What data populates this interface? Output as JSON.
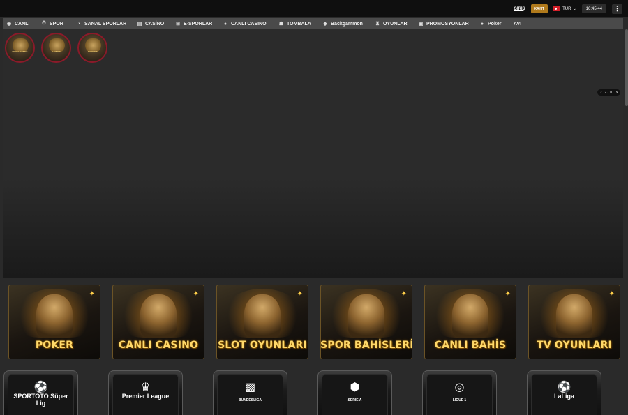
{
  "header": {
    "login_label": "GİRİŞ",
    "register_label": "KAYIT",
    "language": "TUR",
    "clock": "16:45:44",
    "more_icon": "kebab-menu-icon"
  },
  "nav": {
    "items": [
      {
        "label": "CANLI",
        "icon": "live-icon"
      },
      {
        "label": "SPOR",
        "icon": "stopwatch-icon"
      },
      {
        "label": "SANAL SPORLAR",
        "icon": "virtual-sports-icon"
      },
      {
        "label": "CASİNO",
        "icon": "casino-icon"
      },
      {
        "label": "E-SPORLAR",
        "icon": "gamepad-icon"
      },
      {
        "label": "CANLI CASINO",
        "icon": "live-casino-icon"
      },
      {
        "label": "TOMBALA",
        "icon": "bingo-icon"
      },
      {
        "label": "Backgammon",
        "icon": "backgammon-icon"
      },
      {
        "label": "OYUNLAR",
        "icon": "games-icon"
      },
      {
        "label": "PROMOSYONLAR",
        "icon": "gift-icon"
      },
      {
        "label": "Poker",
        "icon": "poker-chip-icon"
      },
      {
        "label": "AVI",
        "icon": ""
      }
    ]
  },
  "stories": [
    {
      "caption": "ROYAL GAMES"
    },
    {
      "caption": "GAMBLE"
    },
    {
      "caption": "JACKPOT"
    }
  ],
  "carousel": {
    "counter": "2 / 10"
  },
  "categories": [
    {
      "label": "POKER"
    },
    {
      "label": "CANLI CASINO"
    },
    {
      "label": "SLOT OYUNLARI"
    },
    {
      "label": "SPOR BAHİSLERİ"
    },
    {
      "label": "CANLI BAHİS"
    },
    {
      "label": "TV OYUNLARI"
    }
  ],
  "leagues": [
    {
      "name": "SPORTOTO Süper Lig"
    },
    {
      "name": "Premier League"
    },
    {
      "name": "BUNDESLIGA"
    },
    {
      "name": "SERIE A"
    },
    {
      "name": "LIGUE 1"
    },
    {
      "name": "LaLiga"
    }
  ]
}
